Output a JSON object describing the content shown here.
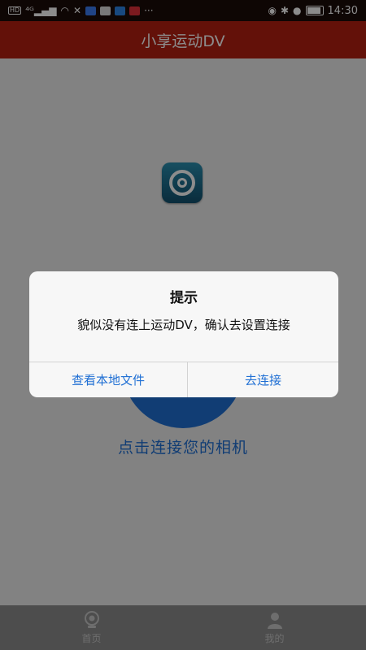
{
  "statusbar": {
    "left_icons": [
      "hd-icon",
      "signal-4g-icon",
      "wifi-icon",
      "app-icon",
      "messenger-icon",
      "wechat-icon",
      "app-c-icon",
      "app-red-icon"
    ],
    "left_more": "···",
    "right_icons": [
      "eye-icon",
      "bluetooth-icon",
      "location-icon",
      "battery-icon"
    ],
    "time": "14:30"
  },
  "titlebar": {
    "title": "小享运动DV"
  },
  "main": {
    "connect_label": "点击连接您的相机"
  },
  "bottomnav": {
    "items": [
      {
        "label": "首页",
        "icon": "home-camera-icon"
      },
      {
        "label": "我的",
        "icon": "user-icon"
      }
    ]
  },
  "dialog": {
    "title": "提示",
    "message": "貌似没有连上运动DV，确认去设置连接",
    "left_button": "查看本地文件",
    "right_button": "去连接"
  },
  "colors": {
    "titlebar": "#b51f12",
    "accent": "#1f6fd4",
    "statusbar": "#1a0b09"
  }
}
